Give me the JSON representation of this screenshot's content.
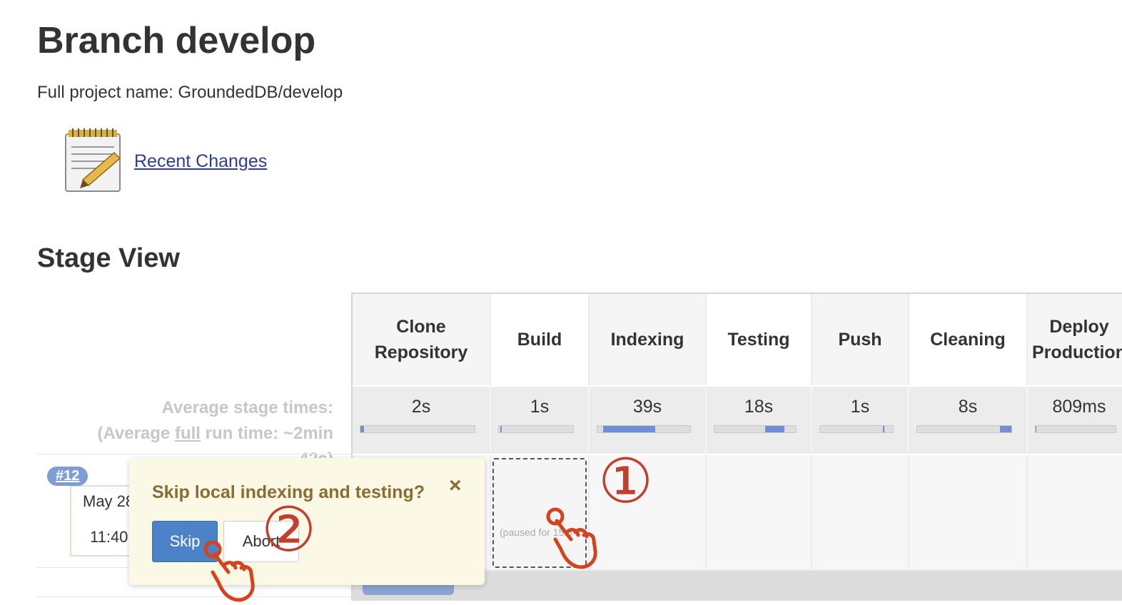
{
  "page": {
    "title": "Branch develop",
    "project_name": "Full project name: GroundedDB/develop",
    "recent_changes": "Recent Changes",
    "stage_view_title": "Stage View"
  },
  "icons": {
    "notepad": "notepad-icon",
    "hand": "pointing-hand-icon",
    "close": "close-icon"
  },
  "colors": {
    "bar_fill": "#6f8ed6",
    "popup_bg": "#fbf9e6",
    "skip_button": "#4b82c8",
    "annotation": "#c33f2b"
  },
  "averages": {
    "line1": "Average stage times:",
    "line2_prefix": "(Average ",
    "line2_link": "full",
    "line2_suffix": " run time: ~2min",
    "line3": "42s)"
  },
  "stages": [
    {
      "name_line1": "Clone",
      "name_line2": "Repository",
      "avg_time": "2s",
      "progress_start": 0.0,
      "progress_end": 0.03
    },
    {
      "name_line1": "Build",
      "name_line2": "",
      "avg_time": "1s",
      "progress_start": 0.02,
      "progress_end": 0.04
    },
    {
      "name_line1": "Indexing",
      "name_line2": "",
      "avg_time": "39s",
      "progress_start": 0.06,
      "progress_end": 0.62
    },
    {
      "name_line1": "Testing",
      "name_line2": "",
      "avg_time": "18s",
      "progress_start": 0.62,
      "progress_end": 0.86
    },
    {
      "name_line1": "Push",
      "name_line2": "",
      "avg_time": "1s",
      "progress_start": 0.86,
      "progress_end": 0.88
    },
    {
      "name_line1": "Cleaning",
      "name_line2": "",
      "avg_time": "8s",
      "progress_start": 0.88,
      "progress_end": 1.0
    },
    {
      "name_line1": "Deploy",
      "name_line2": "Production",
      "avg_time": "809ms",
      "progress_start": 0.0,
      "progress_end": 0.01
    }
  ],
  "build": {
    "number": "#12",
    "date": "May 28",
    "time": "11:40",
    "paused_text": "(paused for 15s)"
  },
  "popup": {
    "question": "Skip local indexing and testing?",
    "close": "×",
    "skip_label": "Skip",
    "abort_label": "Abort"
  },
  "annotations": {
    "step1": "①",
    "step2": "②"
  }
}
